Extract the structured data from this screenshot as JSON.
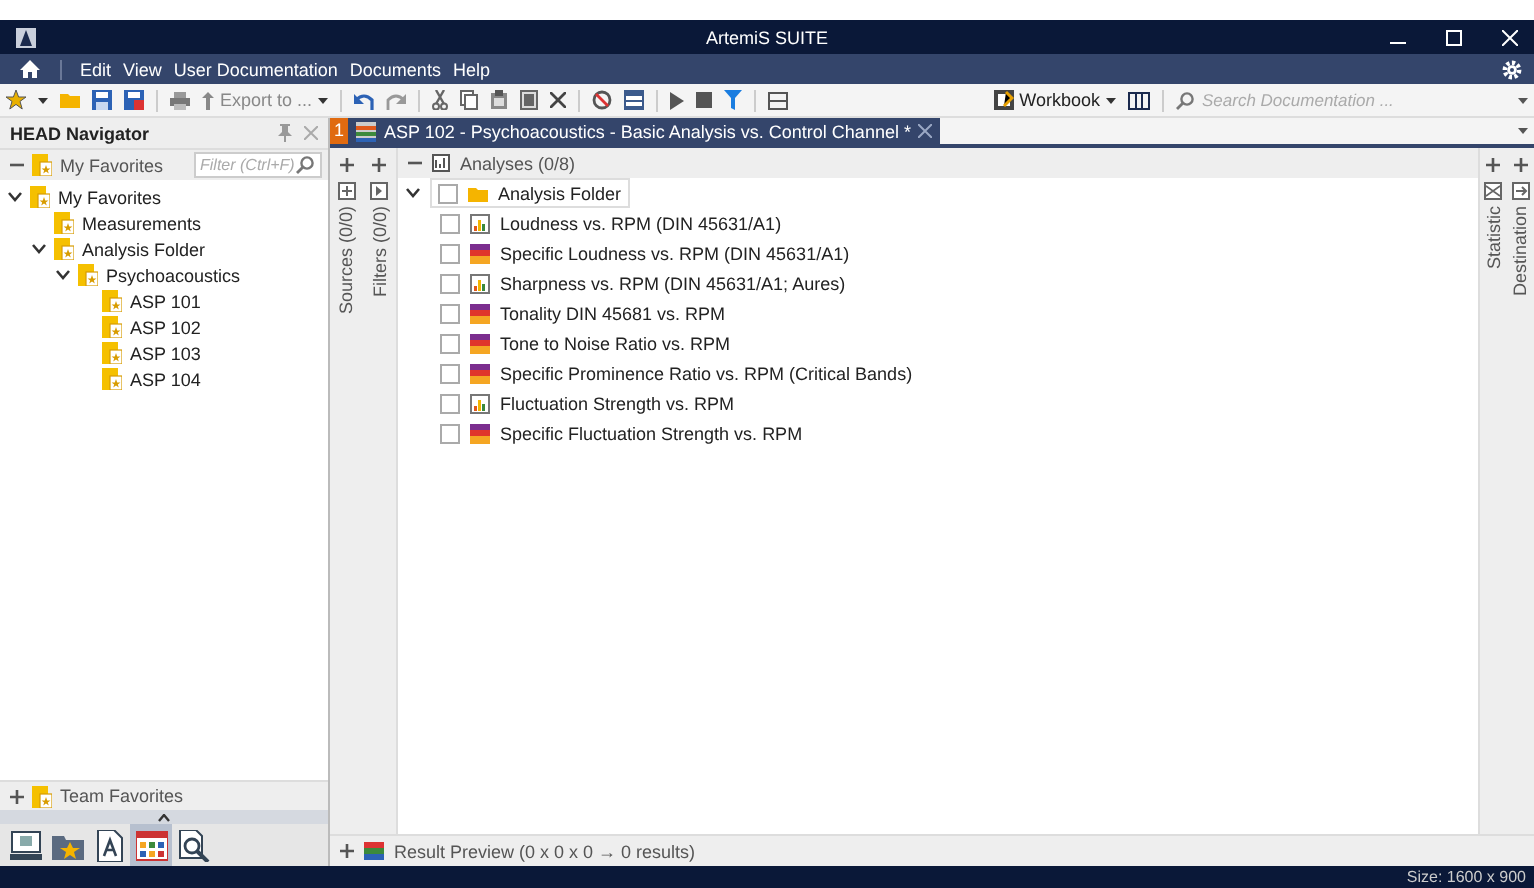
{
  "window": {
    "title": "ArtemiS SUITE"
  },
  "menu": [
    {
      "label": "Edit"
    },
    {
      "label": "View"
    },
    {
      "label": "User Documentation"
    },
    {
      "label": "Documents"
    },
    {
      "label": "Help"
    }
  ],
  "toolbar": {
    "export_label": "Export to ...",
    "workbook_label": "Workbook",
    "search": {
      "placeholder": "Search Documentation ..."
    }
  },
  "navigator": {
    "title": "HEAD Navigator",
    "favorites_label": "My Favorites",
    "filter": {
      "placeholder": "Filter (Ctrl+F)"
    },
    "tree": [
      {
        "label": "My Favorites",
        "expanded": true,
        "children": [
          {
            "label": "Measurements"
          },
          {
            "label": "Analysis Folder",
            "expanded": true,
            "children": [
              {
                "label": "Psychoacoustics",
                "expanded": true,
                "children": [
                  {
                    "label": "ASP 101"
                  },
                  {
                    "label": "ASP 102"
                  },
                  {
                    "label": "ASP 103"
                  },
                  {
                    "label": "ASP 104"
                  }
                ]
              }
            ]
          }
        ]
      }
    ],
    "team_favorites": "Team Favorites",
    "bottom_tools": [
      {
        "kind": "monitor",
        "selected": false
      },
      {
        "kind": "folder",
        "selected": false
      },
      {
        "kind": "document",
        "selected": false
      },
      {
        "kind": "grid",
        "selected": true
      },
      {
        "kind": "search",
        "selected": false
      }
    ]
  },
  "document_tab": {
    "number": "1",
    "title": "ASP 102 - Psychoacoustics - Basic Analysis vs. Control Channel *"
  },
  "side_strips": [
    "Sources (0/0)",
    "Filters (0/0)"
  ],
  "right_strips": [
    "Statistic",
    "Destination"
  ],
  "analyses": {
    "header": "Analyses (0/8)",
    "folder": {
      "label": "Analysis Folder",
      "expanded": true,
      "checked": false
    },
    "items": [
      {
        "label": "Loudness vs. RPM (DIN 45631/A1)",
        "kind": "line",
        "checked": false
      },
      {
        "label": "Specific Loudness vs. RPM (DIN 45631/A1)",
        "kind": "map",
        "checked": false
      },
      {
        "label": "Sharpness vs. RPM (DIN 45631/A1; Aures)",
        "kind": "line",
        "checked": false
      },
      {
        "label": "Tonality DIN 45681 vs. RPM",
        "kind": "map",
        "checked": false
      },
      {
        "label": "Tone to Noise Ratio vs. RPM",
        "kind": "map",
        "checked": false
      },
      {
        "label": "Specific Prominence Ratio vs. RPM (Critical Bands)",
        "kind": "map",
        "checked": false
      },
      {
        "label": "Fluctuation Strength vs. RPM",
        "kind": "line",
        "checked": false
      },
      {
        "label": "Specific Fluctuation Strength vs. RPM",
        "kind": "map",
        "checked": false
      }
    ]
  },
  "result_preview": "Result Preview (0 x 0 x 0 → 0 results)",
  "status": "Size: 1600 x 900"
}
